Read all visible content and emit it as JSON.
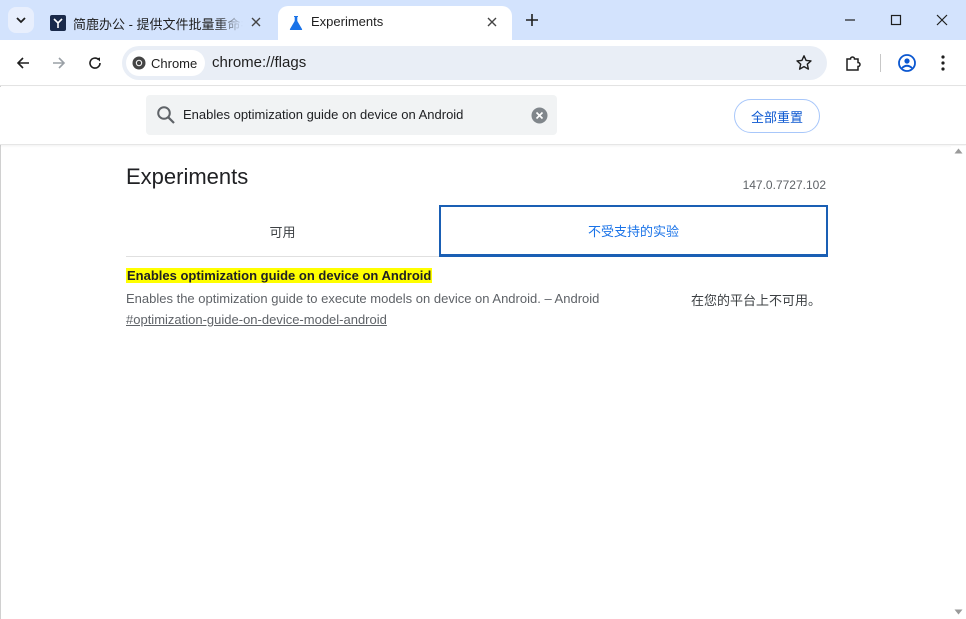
{
  "tabs": [
    {
      "title": "简鹿办公 - 提供文件批量重命名",
      "active": false,
      "favicon": "jianlu-logo-icon"
    },
    {
      "title": "Experiments",
      "active": true,
      "favicon": "flask-icon"
    }
  ],
  "toolbar": {
    "chip_label": "Chrome",
    "url": "chrome://flags"
  },
  "flags": {
    "search_value": "Enables optimization guide on device on Android",
    "reset_label": "全部重置",
    "page_title": "Experiments",
    "version": "147.0.7727.102",
    "tab_available": "可用",
    "tab_unsupported": "不受支持的实验",
    "experiment": {
      "title": "Enables optimization guide on device on Android",
      "description": "Enables the optimization guide to execute models on device on Android. – Android",
      "link": "#optimization-guide-on-device-model-android",
      "status": "在您的平台上不可用。"
    }
  },
  "colors": {
    "tabstrip": "#d3e3fd",
    "accent": "#1a73e8",
    "highlight": "#ffff00"
  }
}
